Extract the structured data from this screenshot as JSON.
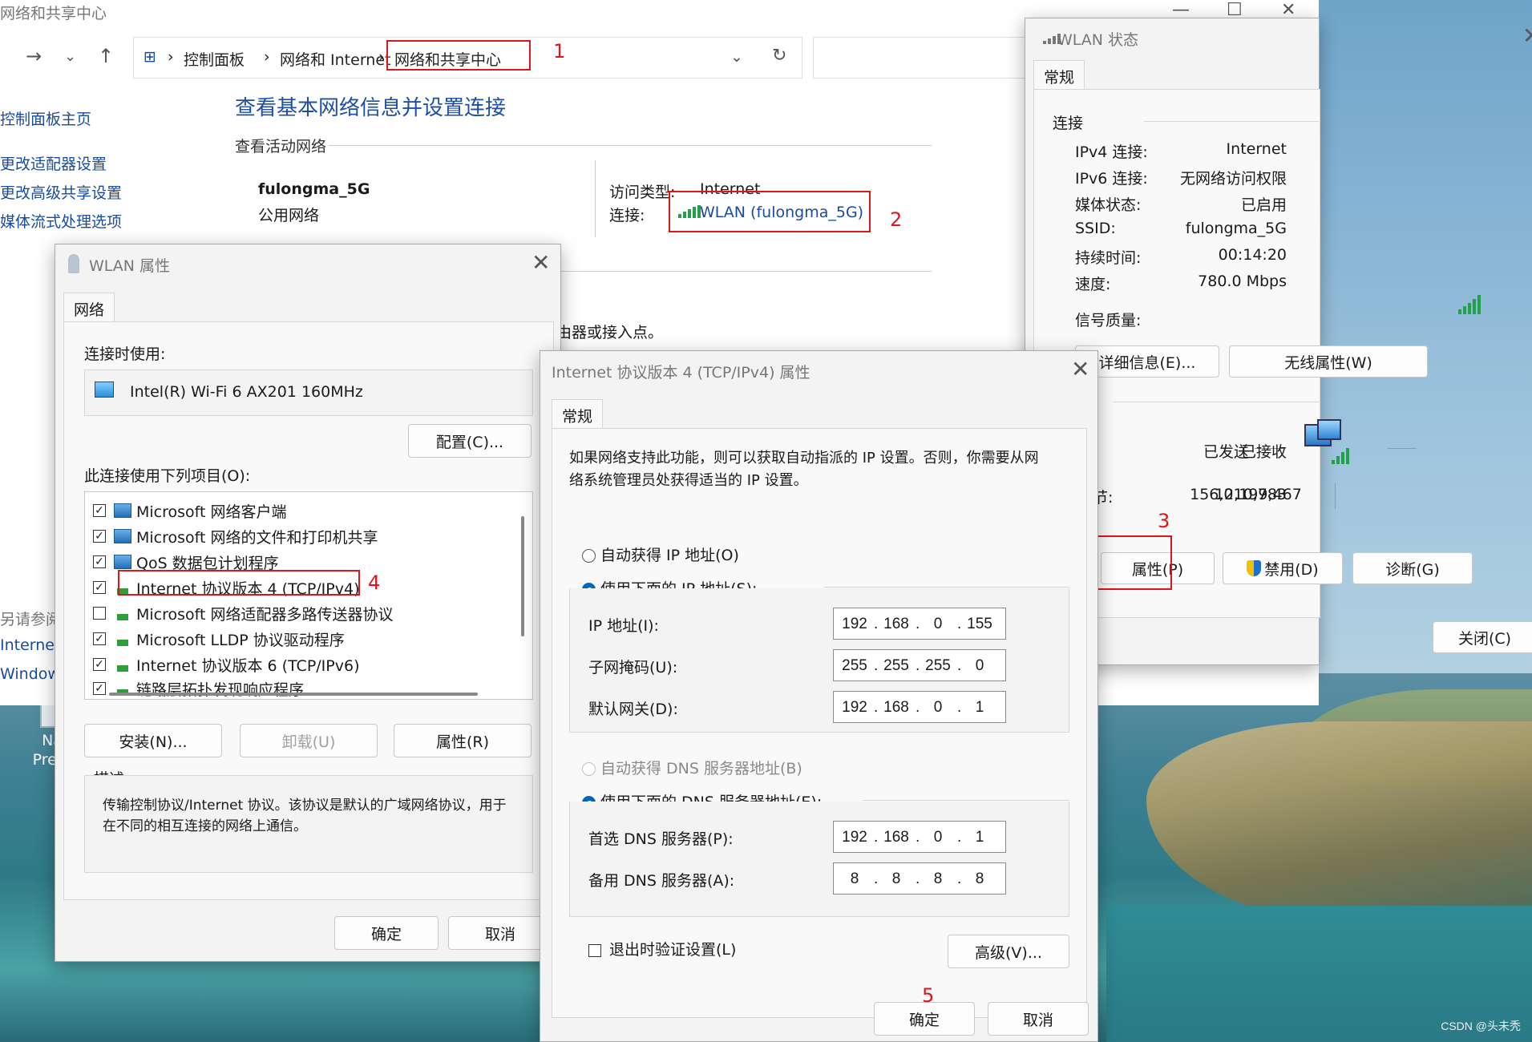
{
  "explorer": {
    "title": "网络和共享中心",
    "breadcrumbs": [
      "控制面板",
      "网络和 Internet",
      "网络和共享中心"
    ],
    "sidebar": [
      "控制面板主页",
      "更改适配器设置",
      "更改高级共享设置",
      "媒体流式处理选项"
    ],
    "see_also": [
      "另请参阅",
      "Internet",
      "Window"
    ],
    "heading": "查看基本网络信息并设置连接",
    "active_networks_label": "查看活动网络",
    "network_name": "fulongma_5G",
    "network_type": "公用网络",
    "access_type_label": "访问类型:",
    "access_type_value": "Internet",
    "connection_label": "连接:",
    "connection_value": "WLAN (fulongma_5G)",
    "partial_text": "由器或接入点。"
  },
  "annotations": [
    "1",
    "2",
    "3",
    "4",
    "5"
  ],
  "wlan_props": {
    "title": "WLAN 属性",
    "tab": "网络",
    "connect_using_label": "连接时使用:",
    "adapter": "Intel(R) Wi-Fi 6 AX201 160MHz",
    "configure_button": "配置(C)...",
    "items_label": "此连接使用下列项目(O):",
    "items": [
      {
        "label": "Microsoft 网络客户端",
        "checked": "✓"
      },
      {
        "label": "Microsoft 网络的文件和打印机共享",
        "checked": "✓"
      },
      {
        "label": "QoS 数据包计划程序",
        "checked": "✓"
      },
      {
        "label": "Internet 协议版本 4 (TCP/IPv4)",
        "checked": "✓"
      },
      {
        "label": "Microsoft 网络适配器多路传送器协议",
        "checked": ""
      },
      {
        "label": "Microsoft LLDP 协议驱动程序",
        "checked": "✓"
      },
      {
        "label": "Internet 协议版本 6 (TCP/IPv6)",
        "checked": "✓"
      },
      {
        "label": "链路层拓扑发现响应程序",
        "checked": "✓"
      }
    ],
    "install_button": "安装(N)...",
    "uninstall_button": "卸载(U)",
    "properties_button": "属性(R)",
    "description_label": "描述",
    "description": "传输控制协议/Internet 协议。该协议是默认的广域网络协议，用于在不同的相互连接的网络上通信。",
    "ok_button": "确定",
    "cancel_button": "取消"
  },
  "ipv4_props": {
    "title": "Internet 协议版本 4 (TCP/IPv4) 属性",
    "tab": "常规",
    "intro": "如果网络支持此功能，则可以获取自动指派的 IP 设置。否则，你需要从网络系统管理员处获得适当的 IP 设置。",
    "auto_ip": "自动获得 IP 地址(O)",
    "manual_ip": "使用下面的 IP 地址(S):",
    "ip_label": "IP 地址(I):",
    "ip": [
      "192",
      "168",
      "0",
      "155"
    ],
    "mask_label": "子网掩码(U):",
    "mask": [
      "255",
      "255",
      "255",
      "0"
    ],
    "gateway_label": "默认网关(D):",
    "gateway": [
      "192",
      "168",
      "0",
      "1"
    ],
    "auto_dns": "自动获得 DNS 服务器地址(B)",
    "manual_dns": "使用下面的 DNS 服务器地址(E):",
    "dns1_label": "首选 DNS 服务器(P):",
    "dns1": [
      "192",
      "168",
      "0",
      "1"
    ],
    "dns2_label": "备用 DNS 服务器(A):",
    "dns2": [
      "8",
      "8",
      "8",
      "8"
    ],
    "validate_label": "退出时验证设置(L)",
    "advanced_button": "高级(V)...",
    "ok_button": "确定",
    "cancel_button": "取消"
  },
  "wlan_status": {
    "title": "WLAN 状态",
    "tab": "常规",
    "connection_label": "连接",
    "rows": [
      {
        "label": "IPv4 连接:",
        "value": "Internet"
      },
      {
        "label": "IPv6 连接:",
        "value": "无网络访问权限"
      },
      {
        "label": "媒体状态:",
        "value": "已启用"
      },
      {
        "label": "SSID:",
        "value": "fulongma_5G"
      },
      {
        "label": "持续时间:",
        "value": "00:14:20"
      },
      {
        "label": "速度:",
        "value": "780.0 Mbps"
      }
    ],
    "signal_label": "信号质量:",
    "details_button": "详细信息(E)...",
    "wireless_button": "无线属性(W)",
    "sent_label": "已发送",
    "received_label": "已接收",
    "bytes_label": "节:",
    "sent_value": "12,199,467",
    "received_value": "156,010,783",
    "properties_button": "属性(P)",
    "disable_button": "禁用(D)",
    "diagnose_button": "诊断(G)",
    "close_button": "关闭(C)"
  },
  "desktop": {
    "icon_label_1": "Na",
    "icon_label_2": "Prem",
    "watermark": "CSDN @头未秃"
  },
  "colors": {
    "link": "#1a4ba0",
    "heading": "#1e4fa6",
    "annotation_red": "#e0141b",
    "signal_green": "#21a14a",
    "radio_blue": "#0067c0"
  }
}
